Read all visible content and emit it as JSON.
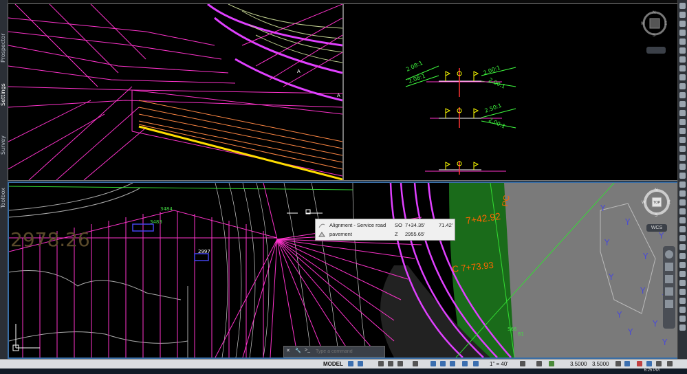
{
  "palette": {
    "tabs": [
      "Prospector",
      "Settings",
      "Survey",
      "Toolbox"
    ]
  },
  "top_left_view": {
    "labels": [
      "A",
      "A"
    ]
  },
  "top_right_view": {
    "slopes": [
      "2.08:1",
      "2.08:1",
      "2.00:1",
      "2.00:1",
      "2.50:1",
      "2.00:1"
    ],
    "compass": {
      "n": "N",
      "s": "S",
      "e": "E",
      "w": "W"
    }
  },
  "bottom_view": {
    "station_text": "2978.26",
    "pc_label": "PC",
    "station_1": "7+42.92",
    "station_2": "C 7+73.93",
    "elev_labels": [
      "3484",
      "3483",
      "2997",
      "566",
      "81"
    ],
    "compass": {
      "n": "N",
      "s": "S",
      "e": "E",
      "w": "W",
      "top": "TOP"
    },
    "wcs_label": "WCS",
    "y_markers": [
      "Y",
      "Y",
      "Y",
      "Y",
      "Y",
      "Y",
      "Y",
      "Y",
      "Y",
      "Y",
      "Y",
      "Y"
    ]
  },
  "tooltip": {
    "row1": {
      "label": "Alignment - Service road",
      "key": "SO",
      "value1": "7+34.35'",
      "value2": "71.42'"
    },
    "row2": {
      "label": "pavement",
      "key": "Z",
      "value1": "2955.65'"
    }
  },
  "command_line": {
    "placeholder": "Type a command"
  },
  "status_bar": {
    "model": "MODEL",
    "scale": "1\" = 40'",
    "value_a": "3.5000",
    "value_b": "3.5000"
  },
  "taskbar": {
    "time": "6:25 PM"
  }
}
